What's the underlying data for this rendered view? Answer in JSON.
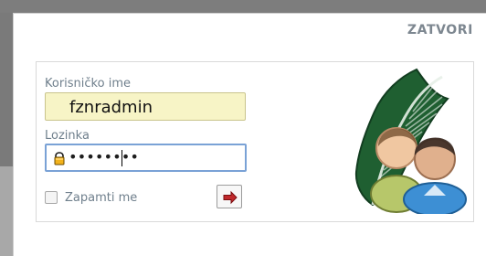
{
  "dialog": {
    "close_label": "ZATVORI"
  },
  "form": {
    "username_label": "Korisničko ime",
    "username_value": "fznradmin",
    "password_label": "Lozinka",
    "password_mask": "••••••••",
    "remember_label": "Zapamti me"
  },
  "icons": {
    "lock": "lock-icon",
    "submit_arrow": "arrow-right-icon",
    "illustration": "users-leaf-illustration"
  },
  "colors": {
    "label": "#6f7f8c",
    "close": "#7d8790",
    "username_bg": "#f7f4c6",
    "password_border": "#7aa2d6",
    "arrow": "#c0282b",
    "leaf": "#1e5b2e"
  }
}
